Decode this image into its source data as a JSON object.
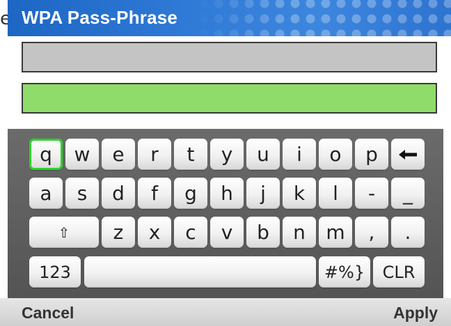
{
  "stray_text": "e",
  "dialog": {
    "title": "WPA Pass-Phrase"
  },
  "fields": {
    "confirm_value": "",
    "entry_value": ""
  },
  "keyboard": {
    "row1": [
      "q",
      "w",
      "e",
      "r",
      "t",
      "y",
      "u",
      "i",
      "o",
      "p",
      "←"
    ],
    "row2": [
      "a",
      "s",
      "d",
      "f",
      "g",
      "h",
      "j",
      "k",
      "l",
      "-",
      "_"
    ],
    "row3": [
      "⇧",
      "z",
      "x",
      "c",
      "v",
      "b",
      "n",
      "m",
      ",",
      "."
    ],
    "row4": [
      "123",
      "",
      "#%}",
      "CLR"
    ],
    "selected_key": "q"
  },
  "footer": {
    "cancel_label": "Cancel",
    "apply_label": "Apply"
  },
  "colors": {
    "header": "#2f7ad6",
    "entry_field": "#8fdc6a",
    "selection_outline": "#2bd42b"
  }
}
